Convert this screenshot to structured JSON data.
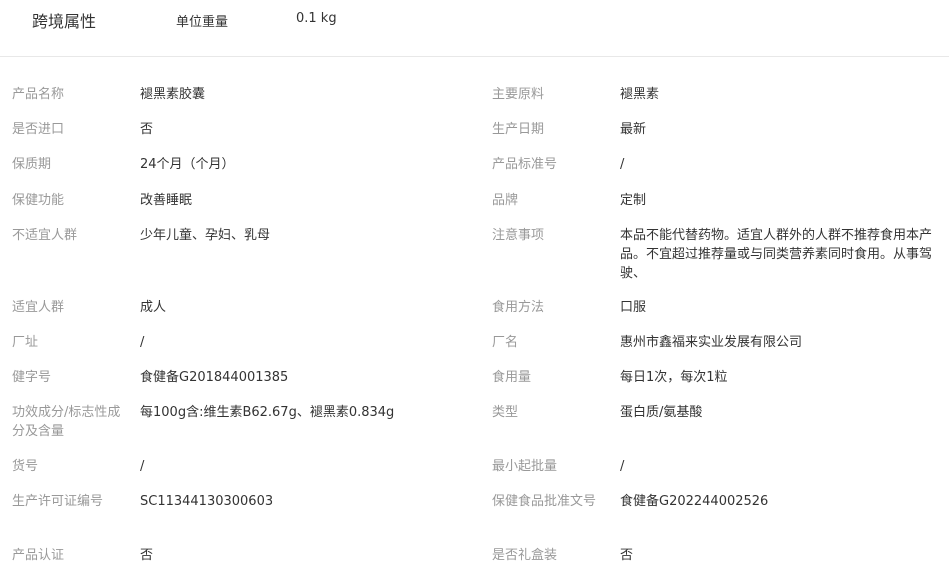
{
  "cross_border": {
    "title": "跨境属性",
    "label": "单位重量",
    "value": "0.1 kg"
  },
  "rows": [
    {
      "left_label": "产品名称",
      "left_value": "褪黑素胶囊",
      "right_label": "主要原料",
      "right_value": "褪黑素"
    },
    {
      "left_label": "是否进口",
      "left_value": "否",
      "right_label": "生产日期",
      "right_value": "最新"
    },
    {
      "left_label": "保质期",
      "left_value": "24个月（个月）",
      "right_label": "产品标准号",
      "right_value": "/"
    },
    {
      "left_label": "保健功能",
      "left_value": "改善睡眠",
      "right_label": "品牌",
      "right_value": "定制"
    },
    {
      "left_label": "不适宜人群",
      "left_value": "少年儿童、孕妇、乳母",
      "right_label": "注意事项",
      "right_value": "本品不能代替药物。适宜人群外的人群不推荐食用本产品。不宜超过推荐量或与同类营养素同时食用。从事驾驶、"
    },
    {
      "left_label": "适宜人群",
      "left_value": "成人",
      "right_label": "食用方法",
      "right_value": "口服"
    },
    {
      "left_label": "厂址",
      "left_value": "/",
      "right_label": "厂名",
      "right_value": "惠州市鑫福来实业发展有限公司"
    },
    {
      "left_label": "健字号",
      "left_value": "食健备G201844001385",
      "right_label": "食用量",
      "right_value": "每日1次，每次1粒"
    },
    {
      "left_label": "功效成分/标志性成分及含量",
      "left_value": "每100g含:维生素B62.67g、褪黑素0.834g",
      "right_label": "类型",
      "right_value": "蛋白质/氨基酸"
    },
    {
      "left_label": "货号",
      "left_value": "/",
      "right_label": "最小起批量",
      "right_value": "/"
    },
    {
      "left_label": "生产许可证编号",
      "left_value": "SC11344130300603",
      "right_label": "保健食品批准文号",
      "right_value": "食健备G202244002526"
    },
    {
      "left_label": "产品认证",
      "left_value": "否",
      "right_label": "是否礼盒装",
      "right_value": "否"
    }
  ]
}
